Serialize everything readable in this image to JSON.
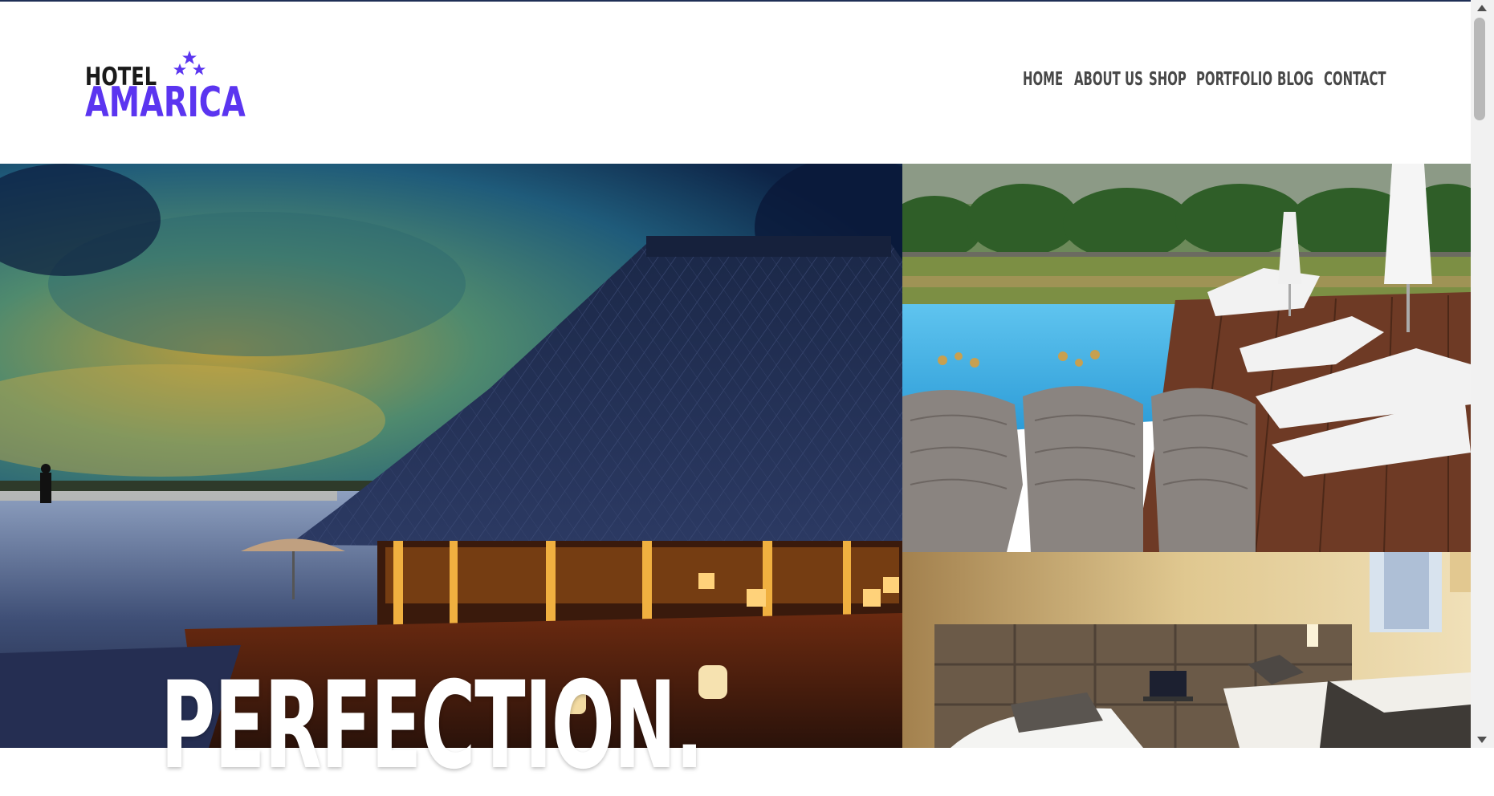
{
  "logo": {
    "line1": "HOTEL",
    "line2": "AMARICA",
    "brand_color": "#5b35f0",
    "icon": "three-stars-icon"
  },
  "nav": {
    "items": [
      {
        "label": "HOME"
      },
      {
        "label": "ABOUT US"
      },
      {
        "label": "SHOP"
      },
      {
        "label": "PORTFOLIO"
      },
      {
        "label": "BLOG"
      },
      {
        "label": "CONTACT"
      }
    ]
  },
  "hero": {
    "title": "PERFECTION.",
    "images": [
      {
        "name": "resort-pavilion-at-dusk-photo"
      },
      {
        "name": "poolside-lounge-chairs-photo"
      },
      {
        "name": "hotel-bedroom-photo"
      }
    ]
  },
  "colors": {
    "accent": "#5b35f0",
    "nav_text": "#484848",
    "top_strip": "#1f2f56"
  }
}
